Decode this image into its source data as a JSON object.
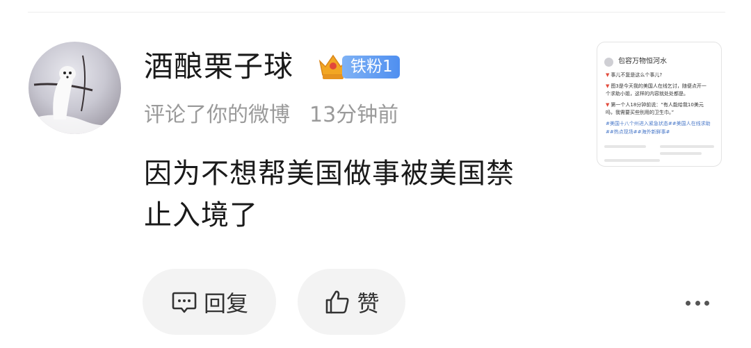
{
  "comment": {
    "username": "酒酿栗子球",
    "fan_badge": "铁粉1",
    "crown_level": "5",
    "action": "评论了你的微博",
    "time": "13分钟前",
    "text_line1": "因为不想帮美国做事被美国禁",
    "text_line2": "止入境了"
  },
  "actions": {
    "reply_label": "回复",
    "like_label": "赞"
  },
  "thumbnail": {
    "author": "包容万物恒河水",
    "line1": "事儿不复是这么个事儿?",
    "line2": "图3是今天我的美国人在线乞讨，随便点开一",
    "line3": "个求助小姐，这样的内容就处处都是。",
    "line4": "第一个人18分钟前说：“有人能给我10美元",
    "line5": "吗，我需要买些别用的卫生巾。”",
    "line6": "#美国十八个州进入紧急状态##美国人在线求助",
    "line7": "##热点现场##海外新鲜事#"
  },
  "icons": [
    "avatar-image",
    "crown-icon",
    "comment-icon",
    "thumbs-up-icon",
    "more-icon"
  ],
  "colors": {
    "fan_badge": "#4f8ff0",
    "crown": "#f2a623",
    "button_bg": "#f3f3f3",
    "muted_text": "#9a9a9a"
  }
}
